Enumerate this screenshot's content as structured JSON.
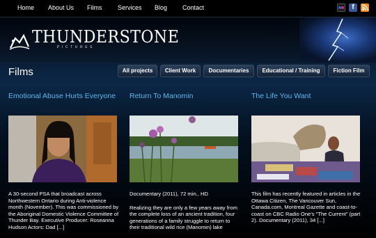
{
  "nav": {
    "items": [
      "Home",
      "About Us",
      "Films",
      "Services",
      "Blog",
      "Contact"
    ]
  },
  "social": {
    "icons": [
      "flickr-icon",
      "facebook-icon",
      "rss-icon"
    ],
    "facebook_glyph": "f"
  },
  "brand": {
    "name": "THUNDERSTONE",
    "tagline": "PICTURES"
  },
  "page": {
    "title": "Films"
  },
  "filters": [
    "All projects",
    "Client Work",
    "Documentaries",
    "Educational / Training",
    "Fiction Film"
  ],
  "films": [
    {
      "title": "Emotional Abuse Hurts Everyone",
      "paragraphs": [
        "A 30-second PSA that broadcast across Northwestern Ontario during Anti-violence month (November). This was commissioned by the Aboriginal Domestic Violence Committee of Thunder Bay. Executive Producer: Roseanna Hudson Actors: Dad [...]"
      ]
    },
    {
      "title": "Return To Manomin",
      "paragraphs": [
        "Documentary (2011), 72 min., HD",
        "Realizing they are only a few years away from the complete loss of an ancient tradition, four generations of a family struggle to return to their traditional wild rice (Manomin) lake"
      ]
    },
    {
      "title": "The Life You Want",
      "paragraphs": [
        "This film has recently featured in articles in the Ottawa Citizen, The Vancouver Sun, Canada.com, Montreal Gazette and coast-to-coast on CBC Radio One's \"The Current\" (part 2). Documentary (2011), 34 [...]"
      ]
    }
  ],
  "colors": {
    "accent": "#5cb7ee",
    "background": "#000000",
    "bar": "#0b2746"
  }
}
